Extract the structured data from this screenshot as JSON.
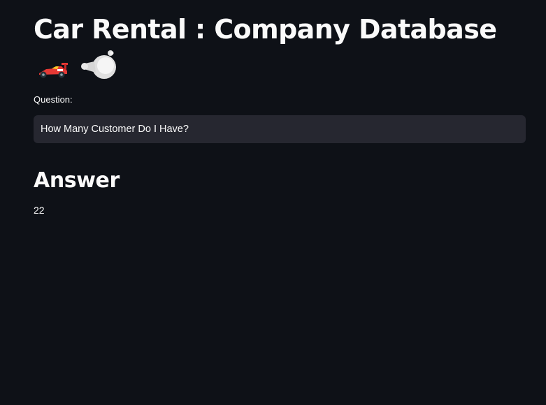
{
  "header": {
    "title": "Car Rental : Company Database",
    "title_icons": [
      "racing-car-icon",
      "dashing-away-icon"
    ]
  },
  "form": {
    "question_label": "Question:",
    "question_value": "How Many Customer Do I Have?"
  },
  "result": {
    "heading": "Answer",
    "value": "22"
  },
  "colors": {
    "background": "#0e1117",
    "input_background": "#262730",
    "text": "#fafafa"
  }
}
